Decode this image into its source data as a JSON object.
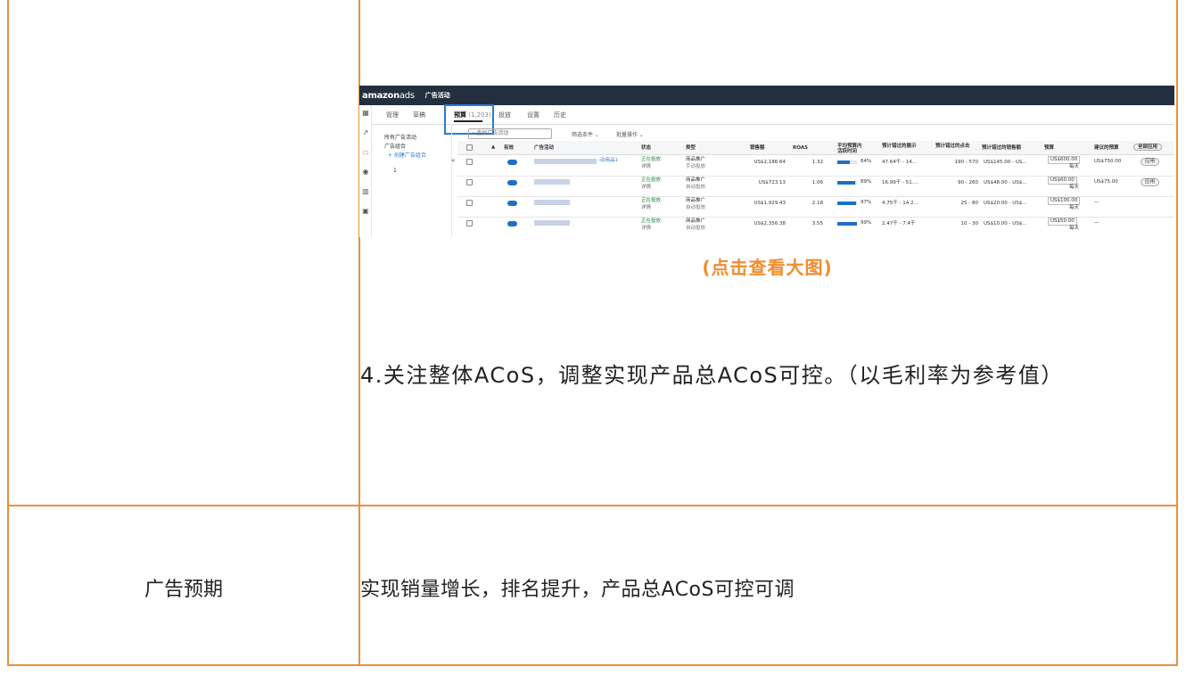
{
  "screenshot": {
    "brand_main": "amazon",
    "brand_sub": "ads",
    "page_title": "广告活动",
    "tabs": [
      "管理",
      "草稿",
      "预算",
      "投放",
      "设置",
      "历史"
    ],
    "active_tab_suffix": "(1,203)",
    "left_nav": {
      "all": "所有广告活动",
      "group": "广告组合",
      "create": "+ 创建广告组合",
      "item": "1"
    },
    "search_placeholder": "查找广告活动",
    "filter_label": "筛选条件",
    "batch_label": "批量操作",
    "columns": [
      "有效",
      "广告活动",
      "状态",
      "类型",
      "销售额",
      "ROAS",
      "平均预算内活跃时间",
      "预计错过的展示",
      "预计错过的点击",
      "预计错过的销售额",
      "预算",
      "建议的预算"
    ],
    "apply_all": "全部应用",
    "rows": [
      {
        "name_suffix": "-动商品1",
        "status": "正在投放",
        "detail": "详情",
        "type1": "商品推广",
        "type2": "手动投放",
        "sales": "US$2,186.64",
        "roas": "1.32",
        "active_pct": 64,
        "active": "64%",
        "imp": "47.64千 - 14...",
        "clicks": "190 - 570",
        "missed_sales": "US$145.00 - US...",
        "budget": "US$600.00",
        "period": "每天",
        "suggest": "US$750.00",
        "apply": "应用"
      },
      {
        "name_suffix": "",
        "status": "正在投放",
        "detail": "详情",
        "type1": "商品推广",
        "type2": "自动投放",
        "sales": "US$723.13",
        "roas": "1.06",
        "active_pct": 89,
        "active": "89%",
        "imp": "16.99千 - 51....",
        "clicks": "90 - 260",
        "missed_sales": "US$48.00 - US$...",
        "budget": "US$60.00",
        "period": "每天",
        "suggest": "US$75.00",
        "apply": "应用"
      },
      {
        "name_suffix": "",
        "status": "正在投放",
        "detail": "详情",
        "type1": "商品推广",
        "type2": "自动投放",
        "sales": "US$1,929.43",
        "roas": "2.18",
        "active_pct": 97,
        "active": "97%",
        "imp": "4.75千 - 14.2...",
        "clicks": "25 - 80",
        "missed_sales": "US$20.00 - US$...",
        "budget": "US$100.00",
        "period": "每天",
        "suggest": "—",
        "apply": ""
      },
      {
        "name_suffix": "",
        "status": "正在投放",
        "detail": "详情",
        "type1": "商品推广",
        "type2": "自动投放",
        "sales": "US$2,356.38",
        "roas": "3.55",
        "active_pct": 99,
        "active": "99%",
        "imp": "2.47千 - 7.4千",
        "clicks": "10 - 30",
        "missed_sales": "US$10.00 - US$...",
        "budget": "US$50.00",
        "period": "每天",
        "suggest": "—",
        "apply": ""
      }
    ]
  },
  "caption": "(点击查看大图)",
  "paragraph": "4.关注整体ACoS，调整实现产品总ACoS可控。（以毛利率为参考值）",
  "label": "广告预期",
  "value": "实现销量增长，排名提升，产品总ACoS可控可调",
  "colors": {
    "border": "#e8913a",
    "caption": "#f08c2c",
    "topbar": "#232f3e",
    "highlight": "#2b7bd1"
  }
}
